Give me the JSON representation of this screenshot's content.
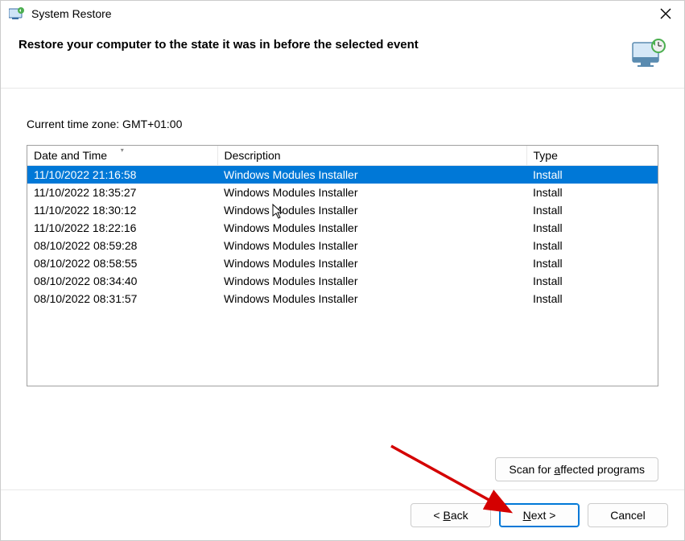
{
  "titlebar": {
    "title": "System Restore"
  },
  "header": {
    "text": "Restore your computer to the state it was in before the selected event"
  },
  "content": {
    "timezone_label": "Current time zone: GMT+01:00",
    "columns": {
      "date_time": "Date and Time",
      "description": "Description",
      "type": "Type"
    },
    "rows": [
      {
        "date": "11/10/2022 21:16:58",
        "desc": "Windows Modules Installer",
        "type": "Install",
        "selected": true
      },
      {
        "date": "11/10/2022 18:35:27",
        "desc": "Windows Modules Installer",
        "type": "Install",
        "selected": false
      },
      {
        "date": "11/10/2022 18:30:12",
        "desc": "Windows Modules Installer",
        "type": "Install",
        "selected": false
      },
      {
        "date": "11/10/2022 18:22:16",
        "desc": "Windows Modules Installer",
        "type": "Install",
        "selected": false
      },
      {
        "date": "08/10/2022 08:59:28",
        "desc": "Windows Modules Installer",
        "type": "Install",
        "selected": false
      },
      {
        "date": "08/10/2022 08:58:55",
        "desc": "Windows Modules Installer",
        "type": "Install",
        "selected": false
      },
      {
        "date": "08/10/2022 08:34:40",
        "desc": "Windows Modules Installer",
        "type": "Install",
        "selected": false
      },
      {
        "date": "08/10/2022 08:31:57",
        "desc": "Windows Modules Installer",
        "type": "Install",
        "selected": false
      }
    ]
  },
  "scan_button": "Scan for affected programs",
  "footer": {
    "back": "< Back",
    "next": "Next >",
    "cancel": "Cancel"
  }
}
